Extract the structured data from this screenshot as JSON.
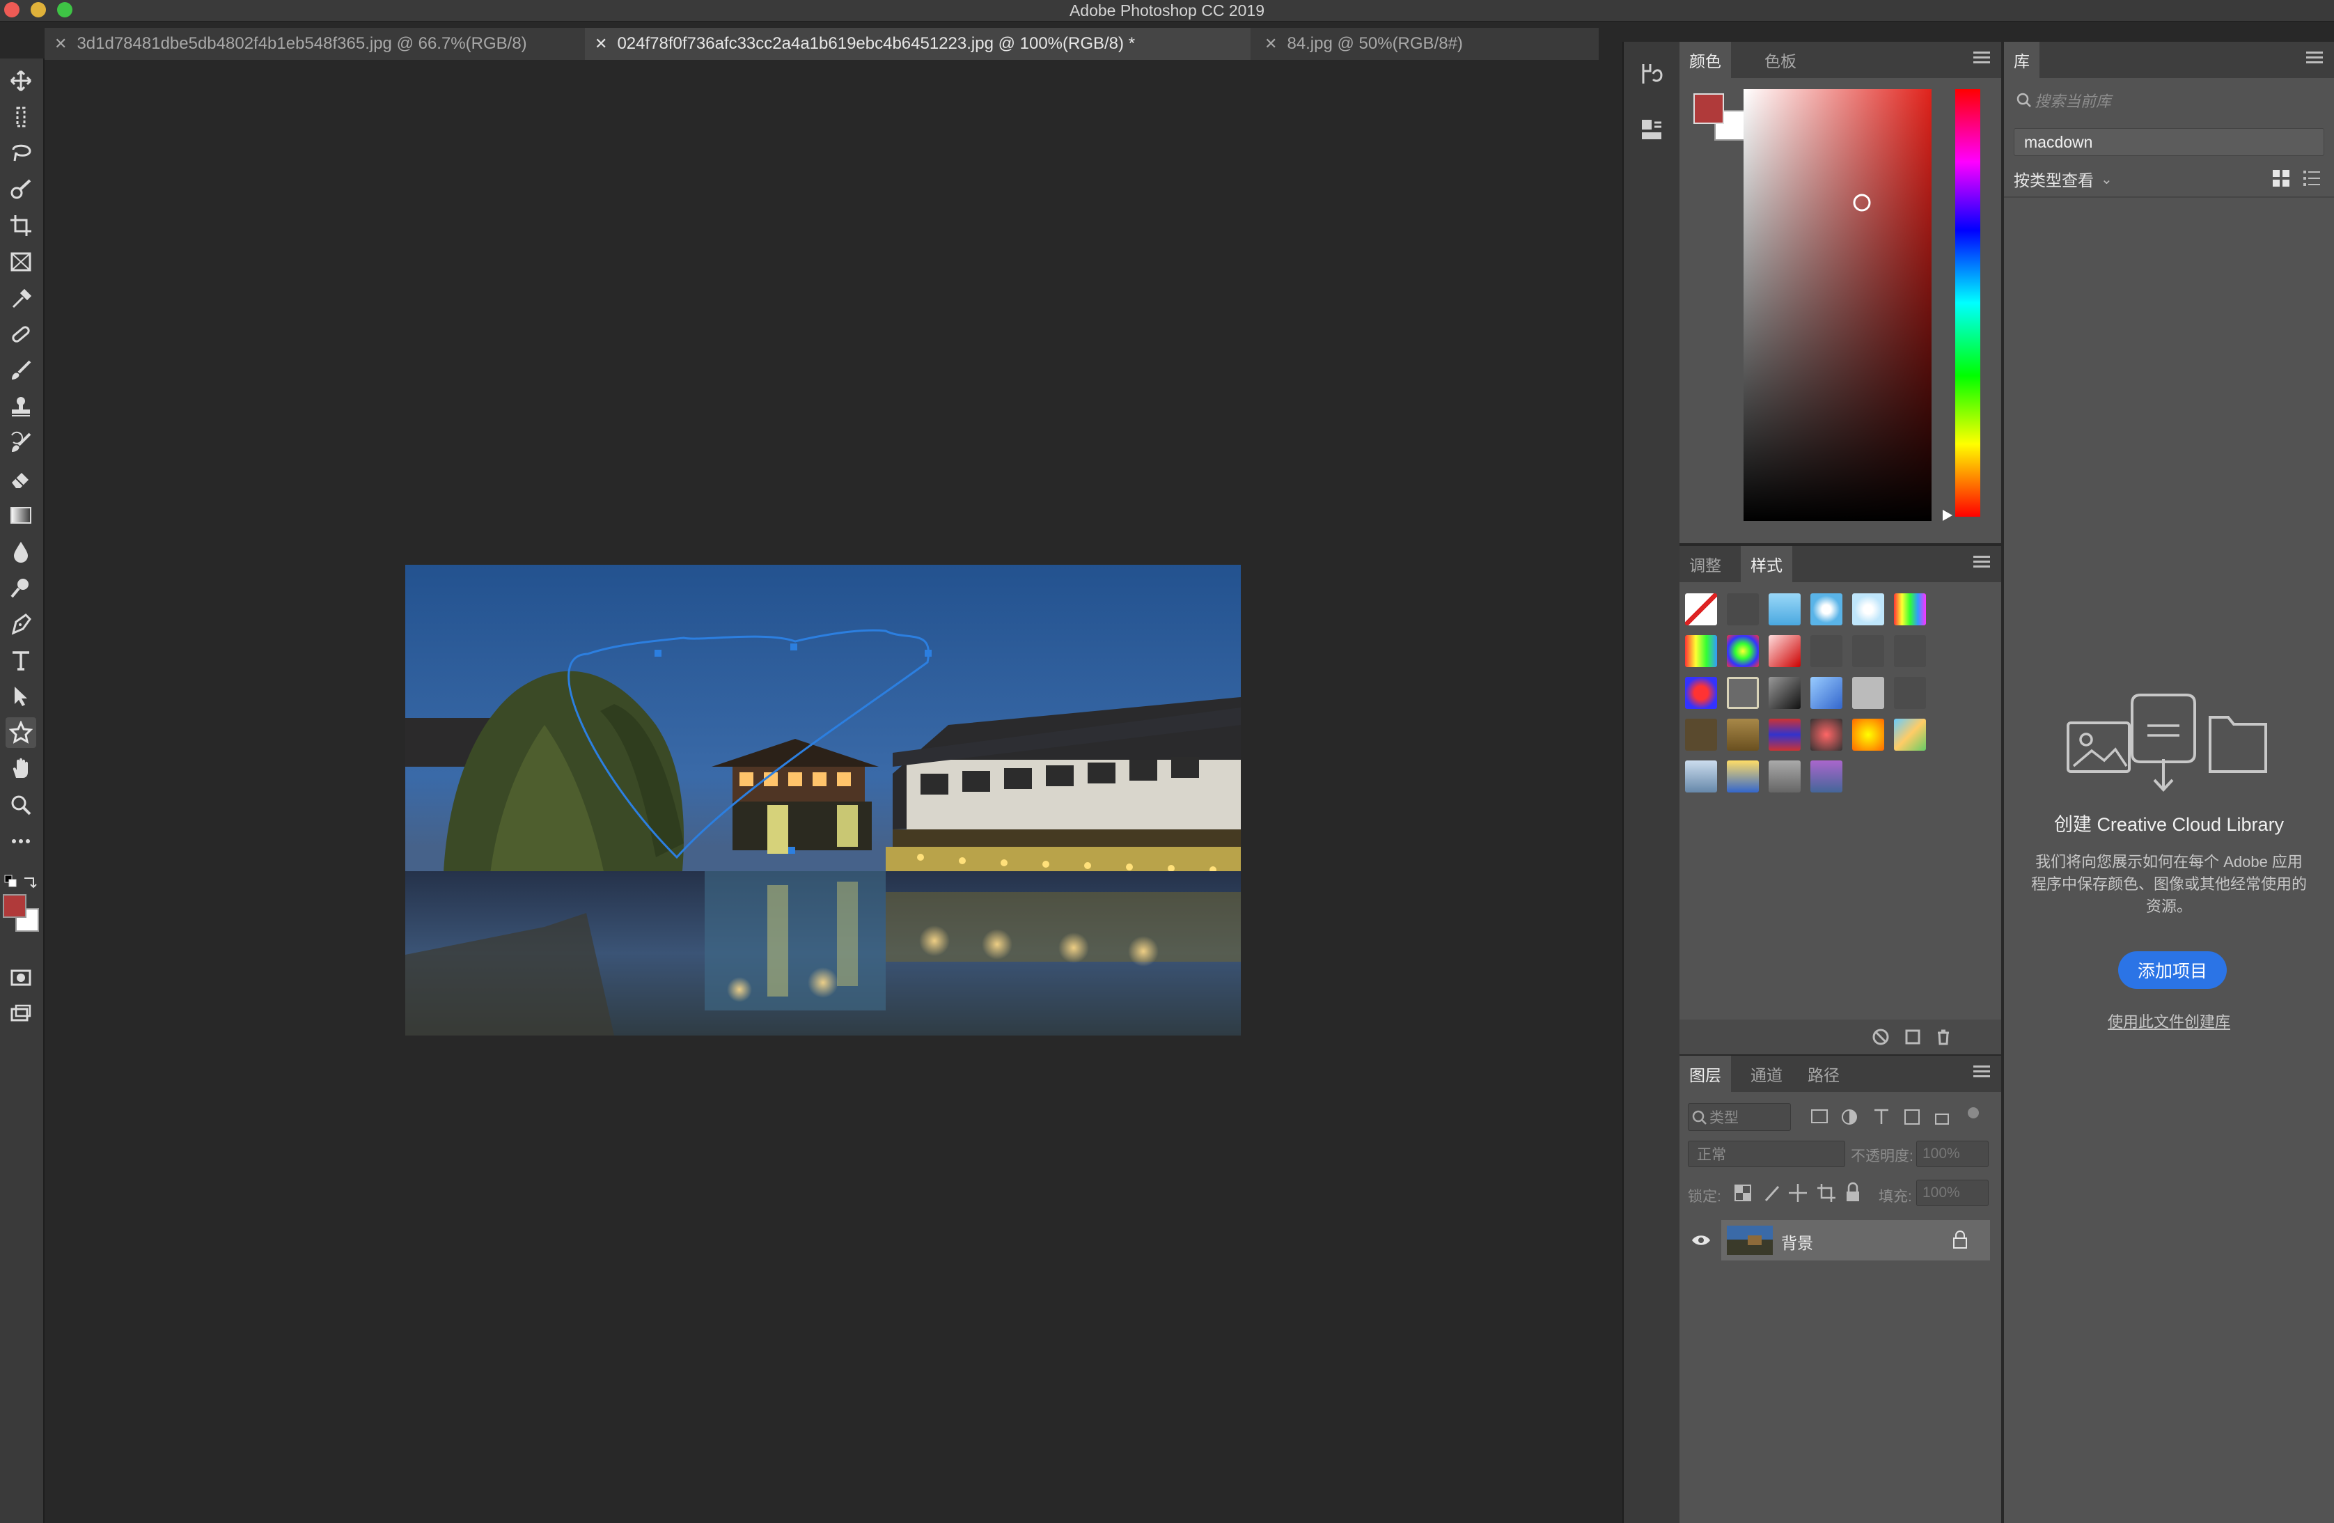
{
  "window": {
    "title": "Adobe Photoshop CC 2019"
  },
  "tabs": [
    {
      "label": "3d1d78481dbe5db4802f4b1eb548f365.jpg @ 66.7%(RGB/8)",
      "active": false
    },
    {
      "label": "024f78f0f736afc33cc2a4a1b619ebc4b6451223.jpg @ 100%(RGB/8) *",
      "active": true
    },
    {
      "label": "84.jpg @ 50%(RGB/8#)",
      "active": false
    }
  ],
  "colors": {
    "foreground": "#b03a3a",
    "background": "#ffffff",
    "accent_blue": "#2b74e6"
  },
  "color_panel": {
    "tab_color": "颜色",
    "tab_swatches": "色板"
  },
  "styles_panel": {
    "tab_adjust": "调整",
    "tab_styles": "样式"
  },
  "layers_panel": {
    "tab_layers": "图层",
    "tab_channels": "通道",
    "tab_paths": "路径",
    "filter_kind": "类型",
    "blend_mode": "正常",
    "opacity_label": "不透明度:",
    "opacity_value": "100%",
    "lock_label": "锁定:",
    "fill_label": "填充:",
    "fill_value": "100%",
    "layers": [
      {
        "name": "背景",
        "locked": true,
        "visible": true
      }
    ]
  },
  "library_panel": {
    "tab": "库",
    "search_placeholder": "搜索当前库",
    "library_name": "macdown",
    "view_by_type": "按类型查看",
    "heading": "创建 Creative Cloud Library",
    "description": "我们将向您展示如何在每个 Adobe 应用程序中保存颜色、图像或其他经常使用的资源。",
    "add_button": "添加项目",
    "link": "使用此文件创建库"
  },
  "icons": [
    "move-icon",
    "marquee-icon",
    "lasso-icon",
    "quick-select-icon",
    "crop-icon",
    "frame-icon",
    "eyedropper-icon",
    "healing-icon",
    "brush-icon",
    "stamp-icon",
    "history-brush-icon",
    "eraser-icon",
    "gradient-icon",
    "blur-icon",
    "dodge-icon",
    "pen-icon",
    "type-icon",
    "path-select-icon",
    "custom-shape-icon",
    "hand-icon",
    "zoom-icon",
    "more-icon"
  ]
}
